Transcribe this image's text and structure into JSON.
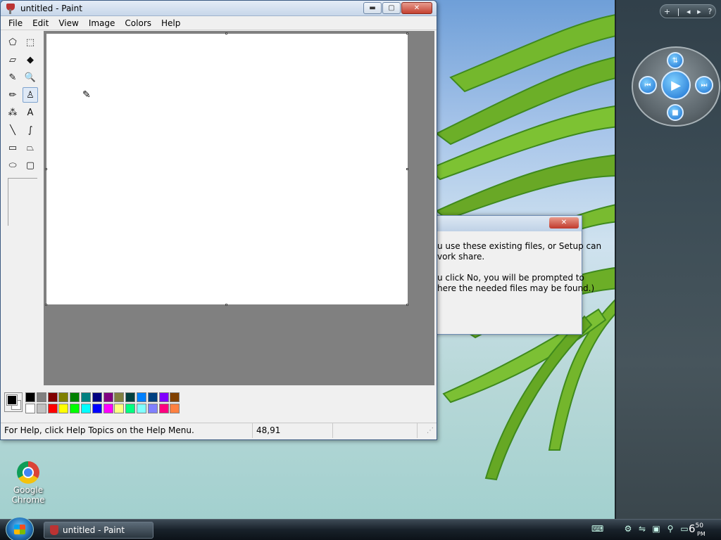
{
  "paint": {
    "title": "untitled - Paint",
    "window_buttons": {
      "minimize": "▬",
      "maximize": "▢",
      "close": "✕"
    },
    "menu": [
      "File",
      "Edit",
      "View",
      "Image",
      "Colors",
      "Help"
    ],
    "tools": [
      {
        "name": "free-form-select-icon",
        "glyph": "⬠"
      },
      {
        "name": "rect-select-icon",
        "glyph": "⬚"
      },
      {
        "name": "eraser-icon",
        "glyph": "▱"
      },
      {
        "name": "fill-bucket-icon",
        "glyph": "◆"
      },
      {
        "name": "color-picker-icon",
        "glyph": "✎"
      },
      {
        "name": "magnifier-icon",
        "glyph": "🔍"
      },
      {
        "name": "pencil-icon",
        "glyph": "✏"
      },
      {
        "name": "brush-icon",
        "glyph": "♙"
      },
      {
        "name": "airbrush-icon",
        "glyph": "⁂"
      },
      {
        "name": "text-icon",
        "glyph": "A"
      },
      {
        "name": "line-icon",
        "glyph": "╲"
      },
      {
        "name": "curve-icon",
        "glyph": "∫"
      },
      {
        "name": "rectangle-icon",
        "glyph": "▭"
      },
      {
        "name": "polygon-icon",
        "glyph": "⏢"
      },
      {
        "name": "ellipse-icon",
        "glyph": "⬭"
      },
      {
        "name": "rounded-rect-icon",
        "glyph": "▢"
      }
    ],
    "selected_tool": "brush-icon",
    "palette_top": [
      "#000000",
      "#808080",
      "#800000",
      "#808000",
      "#008000",
      "#008080",
      "#000080",
      "#800080",
      "#808040",
      "#004040",
      "#0080ff",
      "#004080",
      "#8000ff",
      "#804000"
    ],
    "palette_bottom": [
      "#ffffff",
      "#c0c0c0",
      "#ff0000",
      "#ffff00",
      "#00ff00",
      "#00ffff",
      "#0000ff",
      "#ff00ff",
      "#ffff80",
      "#00ff80",
      "#80ffff",
      "#8080ff",
      "#ff0080",
      "#ff8040"
    ],
    "foreground_color": "#000000",
    "background_color": "#ffffff",
    "status": {
      "help": "For Help, click Help Topics on the Help Menu.",
      "coords": "48,91",
      "size": ""
    }
  },
  "dialog": {
    "line1": "u use these existing files, or Setup can",
    "line2": "vork share.",
    "line3": "u click No, you will be prompted to",
    "line4": "here the needed files may be found.)"
  },
  "desktop": {
    "icon_label": "Google Chrome"
  },
  "sidebar": {
    "controls": [
      "+",
      "|",
      "◂",
      "▸",
      "?"
    ]
  },
  "taskbar": {
    "task_label": "untitled - Paint",
    "clock_hour": "6",
    "clock_min": "50",
    "clock_ampm": "PM"
  }
}
